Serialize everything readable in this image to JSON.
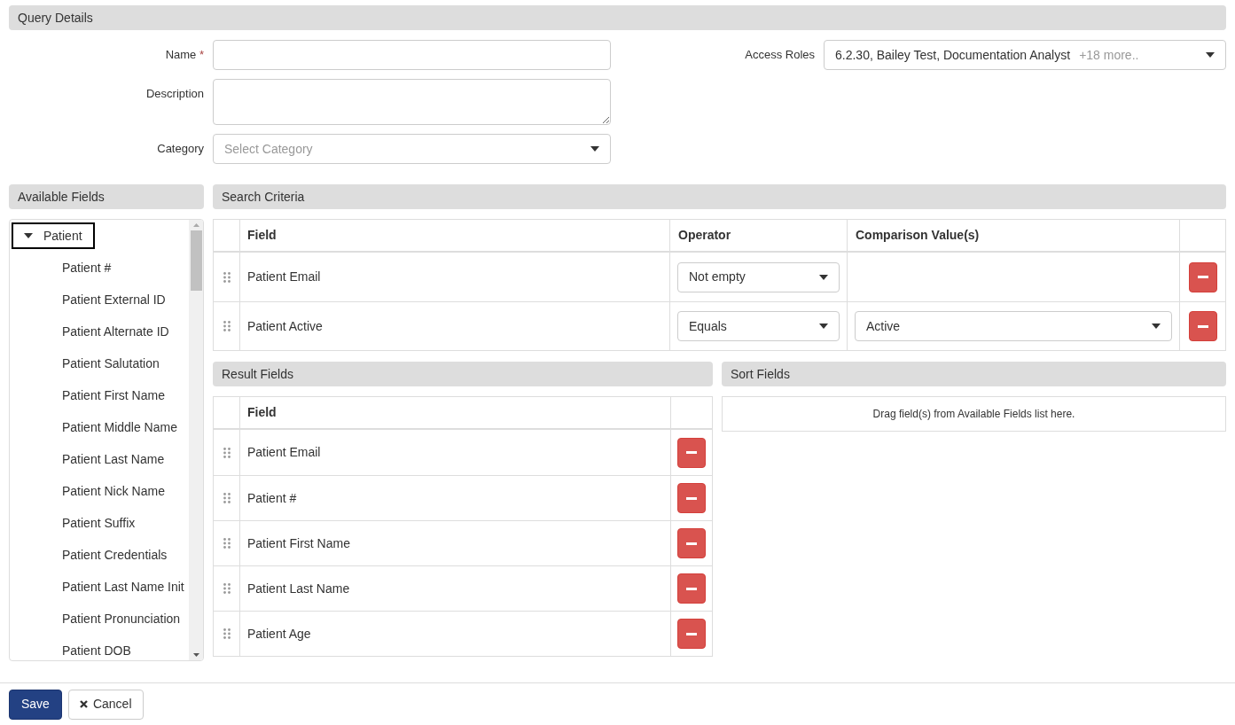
{
  "query_details": {
    "title": "Query Details",
    "name": {
      "label": "Name",
      "required_mark": "*"
    },
    "description": {
      "label": "Description"
    },
    "category": {
      "label": "Category",
      "placeholder": "Select Category"
    },
    "access_roles": {
      "label": "Access Roles",
      "value": "6.2.30, Bailey Test, Documentation Analyst",
      "more": "+18 more.."
    }
  },
  "available_fields": {
    "title": "Available Fields",
    "tree": [
      {
        "label": "Patient",
        "expanded": true,
        "focused": true,
        "children": [
          {
            "label": "Patient #"
          },
          {
            "label": "Patient External ID"
          },
          {
            "label": "Patient Alternate ID"
          },
          {
            "label": "Patient Salutation"
          },
          {
            "label": "Patient First Name"
          },
          {
            "label": "Patient Middle Name"
          },
          {
            "label": "Patient Last Name"
          },
          {
            "label": "Patient Nick Name"
          },
          {
            "label": "Patient Suffix"
          },
          {
            "label": "Patient Credentials"
          },
          {
            "label": "Patient Last Name Init"
          },
          {
            "label": "Patient Pronunciation"
          },
          {
            "label": "Patient DOB"
          }
        ]
      }
    ]
  },
  "search_criteria": {
    "title": "Search Criteria",
    "columns": [
      "Field",
      "Operator",
      "Comparison Value(s)"
    ],
    "rows": [
      {
        "field": "Patient Email",
        "operator": "Not empty"
      },
      {
        "field": "Patient Active",
        "operator": "Equals",
        "value": "Active"
      }
    ]
  },
  "result_fields": {
    "title": "Result Fields",
    "columns": [
      "Field"
    ],
    "rows": [
      {
        "field": "Patient Email"
      },
      {
        "field": "Patient #"
      },
      {
        "field": "Patient First Name"
      },
      {
        "field": "Patient Last Name"
      },
      {
        "field": "Patient Age"
      }
    ]
  },
  "sort_fields": {
    "title": "Sort Fields",
    "empty_text": "Drag field(s) from Available Fields list here."
  },
  "buttons": [
    {
      "kind": "primary",
      "label": "Save"
    },
    {
      "kind": "cancel",
      "label": "Cancel"
    }
  ]
}
